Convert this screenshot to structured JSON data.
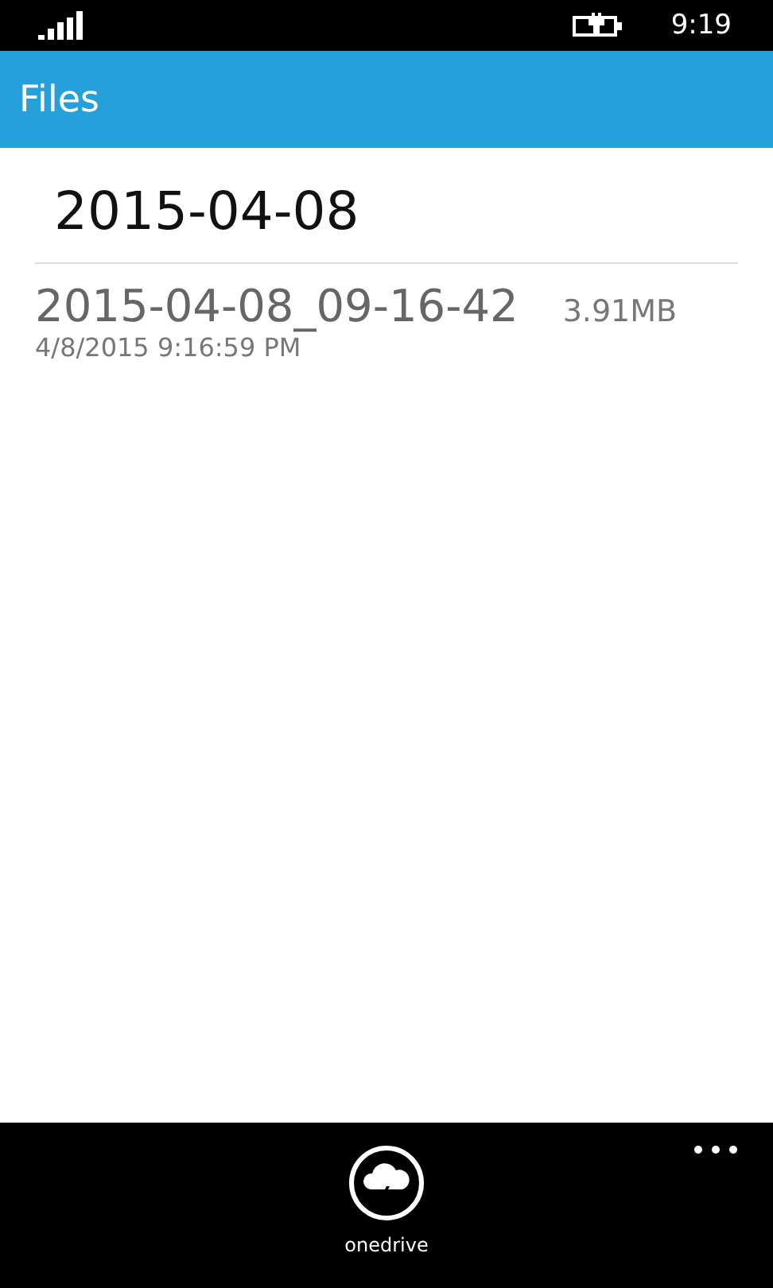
{
  "status_bar": {
    "time": "9:19"
  },
  "header": {
    "title": "Files"
  },
  "group": {
    "title": "2015-04-08"
  },
  "files": [
    {
      "name": "2015-04-08_09-16-42",
      "size": "3.91MB",
      "date": "4/8/2015 9:16:59 PM"
    }
  ],
  "app_bar": {
    "buttons": [
      {
        "label": "onedrive"
      }
    ]
  }
}
